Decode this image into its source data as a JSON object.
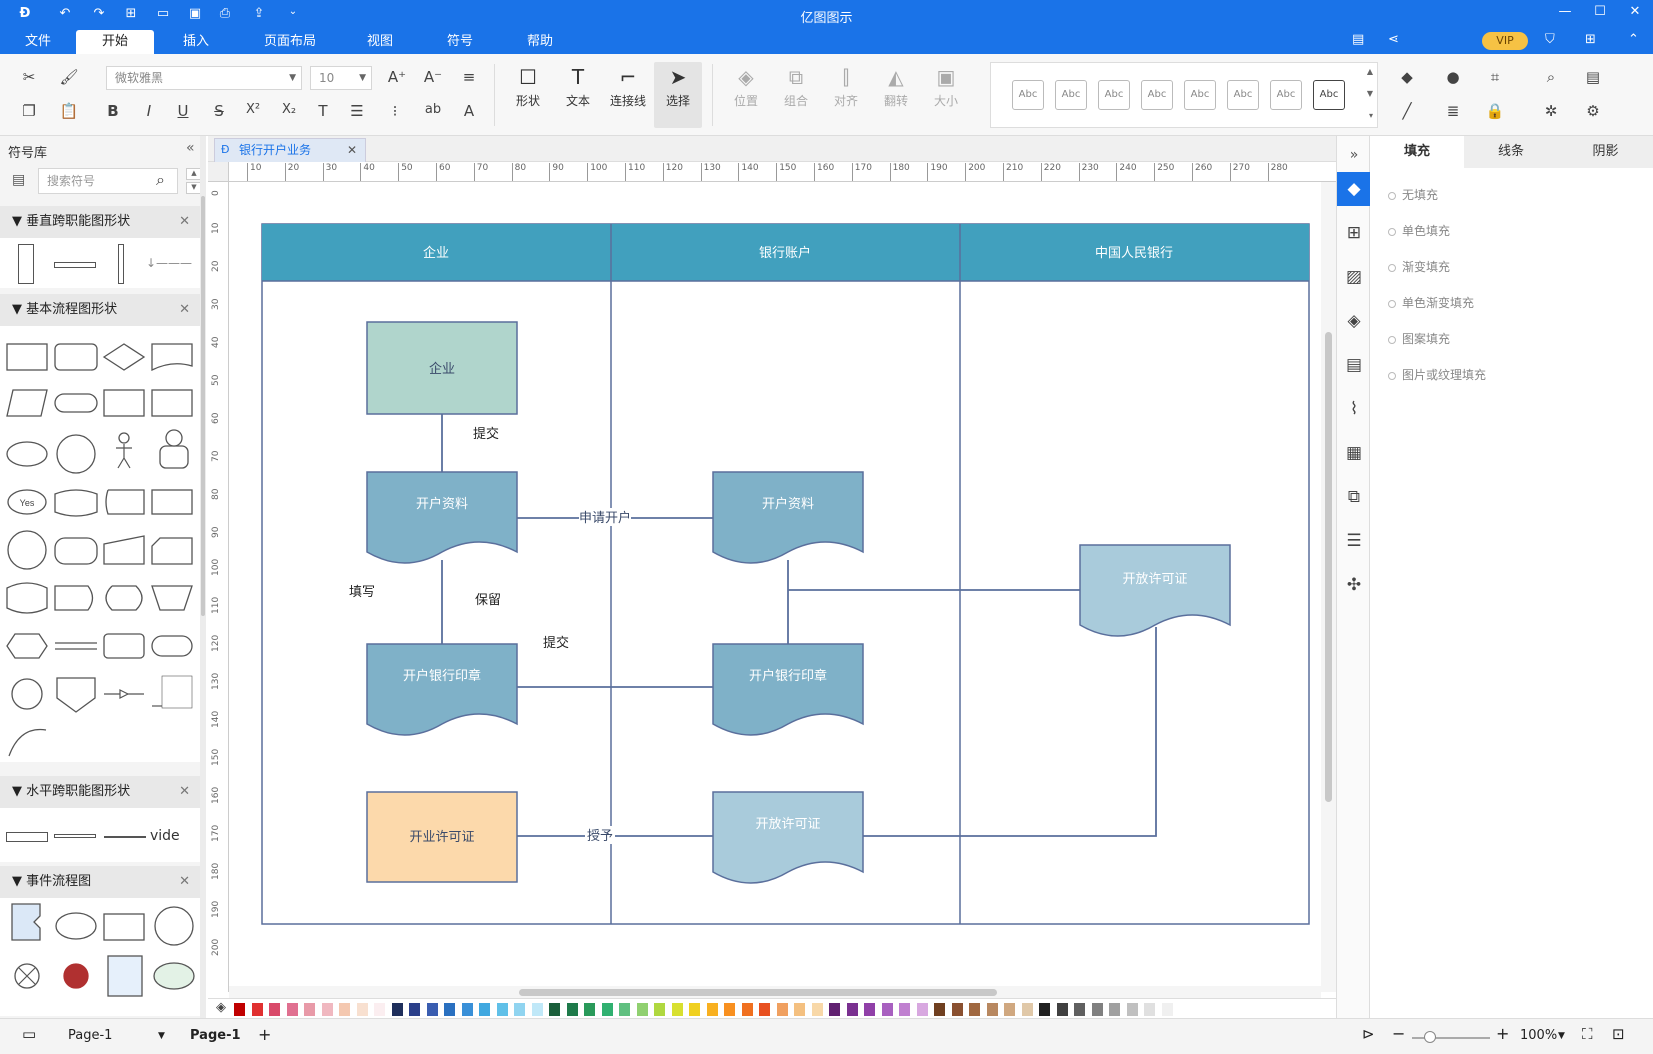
{
  "app": {
    "title": "亿图图示"
  },
  "menu_tabs": [
    "文件",
    "开始",
    "插入",
    "页面布局",
    "视图",
    "符号",
    "帮助"
  ],
  "menu_active": "开始",
  "vip_badge": "VIP",
  "ribbon": {
    "font_name": "微软雅黑",
    "font_size": "10",
    "buttons": {
      "shape": "形状",
      "text": "文本",
      "connector": "连接线",
      "select": "选择",
      "position": "位置",
      "group": "组合",
      "align": "对齐",
      "flip": "翻转",
      "size": "大小"
    },
    "style_sample": "Abc",
    "format": {
      "bold": "B",
      "italic": "I",
      "underline": "U",
      "strike": "S",
      "sup": "X²",
      "sub": "X₂",
      "case": "ab"
    }
  },
  "left_panel": {
    "title": "符号库",
    "search_placeholder": "搜索符号",
    "categories": [
      "垂直跨职能图形状",
      "基本流程图形状",
      "水平跨职能图形状",
      "事件流程图"
    ],
    "yes_label": "Yes",
    "vide_label": "vide"
  },
  "doc_tab": "银行开户业务",
  "ruler_h": [
    "10",
    "20",
    "30",
    "40",
    "50",
    "60",
    "70",
    "80",
    "90",
    "100",
    "110",
    "120",
    "130",
    "140",
    "150",
    "160",
    "170",
    "180",
    "190",
    "200",
    "210",
    "220",
    "230",
    "240",
    "250",
    "260",
    "270",
    "280"
  ],
  "ruler_v": [
    "0",
    "10",
    "20",
    "30",
    "40",
    "50",
    "60",
    "70",
    "80",
    "90",
    "100",
    "110",
    "120",
    "130",
    "140",
    "150",
    "160",
    "170",
    "180",
    "190",
    "200"
  ],
  "diagram": {
    "lanes": [
      "企业",
      "银行账户",
      "中国人民银行"
    ],
    "nodes": {
      "n1": "企业",
      "n2": "开户资料",
      "n3": "开户银行印章",
      "n4": "开业许可证",
      "n5": "开户资料",
      "n6": "开户银行印章",
      "n7": "开放许可证",
      "n8": "开放许可证"
    },
    "labels": {
      "submit1": "提交",
      "apply": "申请开户",
      "fill": "填写",
      "keep": "保留",
      "submit2": "提交",
      "grant": "授予"
    }
  },
  "right_panel": {
    "tabs": [
      "填充",
      "线条",
      "阴影"
    ],
    "fill_options": [
      "无填充",
      "单色填充",
      "渐变填充",
      "单色渐变填充",
      "图案填充",
      "图片或纹理填充"
    ]
  },
  "status": {
    "page_select": "Page-1",
    "page_tab": "Page-1",
    "zoom": "100%"
  },
  "colors": {
    "accent": "#1a73e8",
    "lane_header": "#41a0be",
    "node_blue": "#7fb1c8",
    "node_light": "#a9cbdb",
    "node_green": "#b0d5cc",
    "node_orange": "#fcd9ab",
    "stroke": "#5a6f9c"
  }
}
